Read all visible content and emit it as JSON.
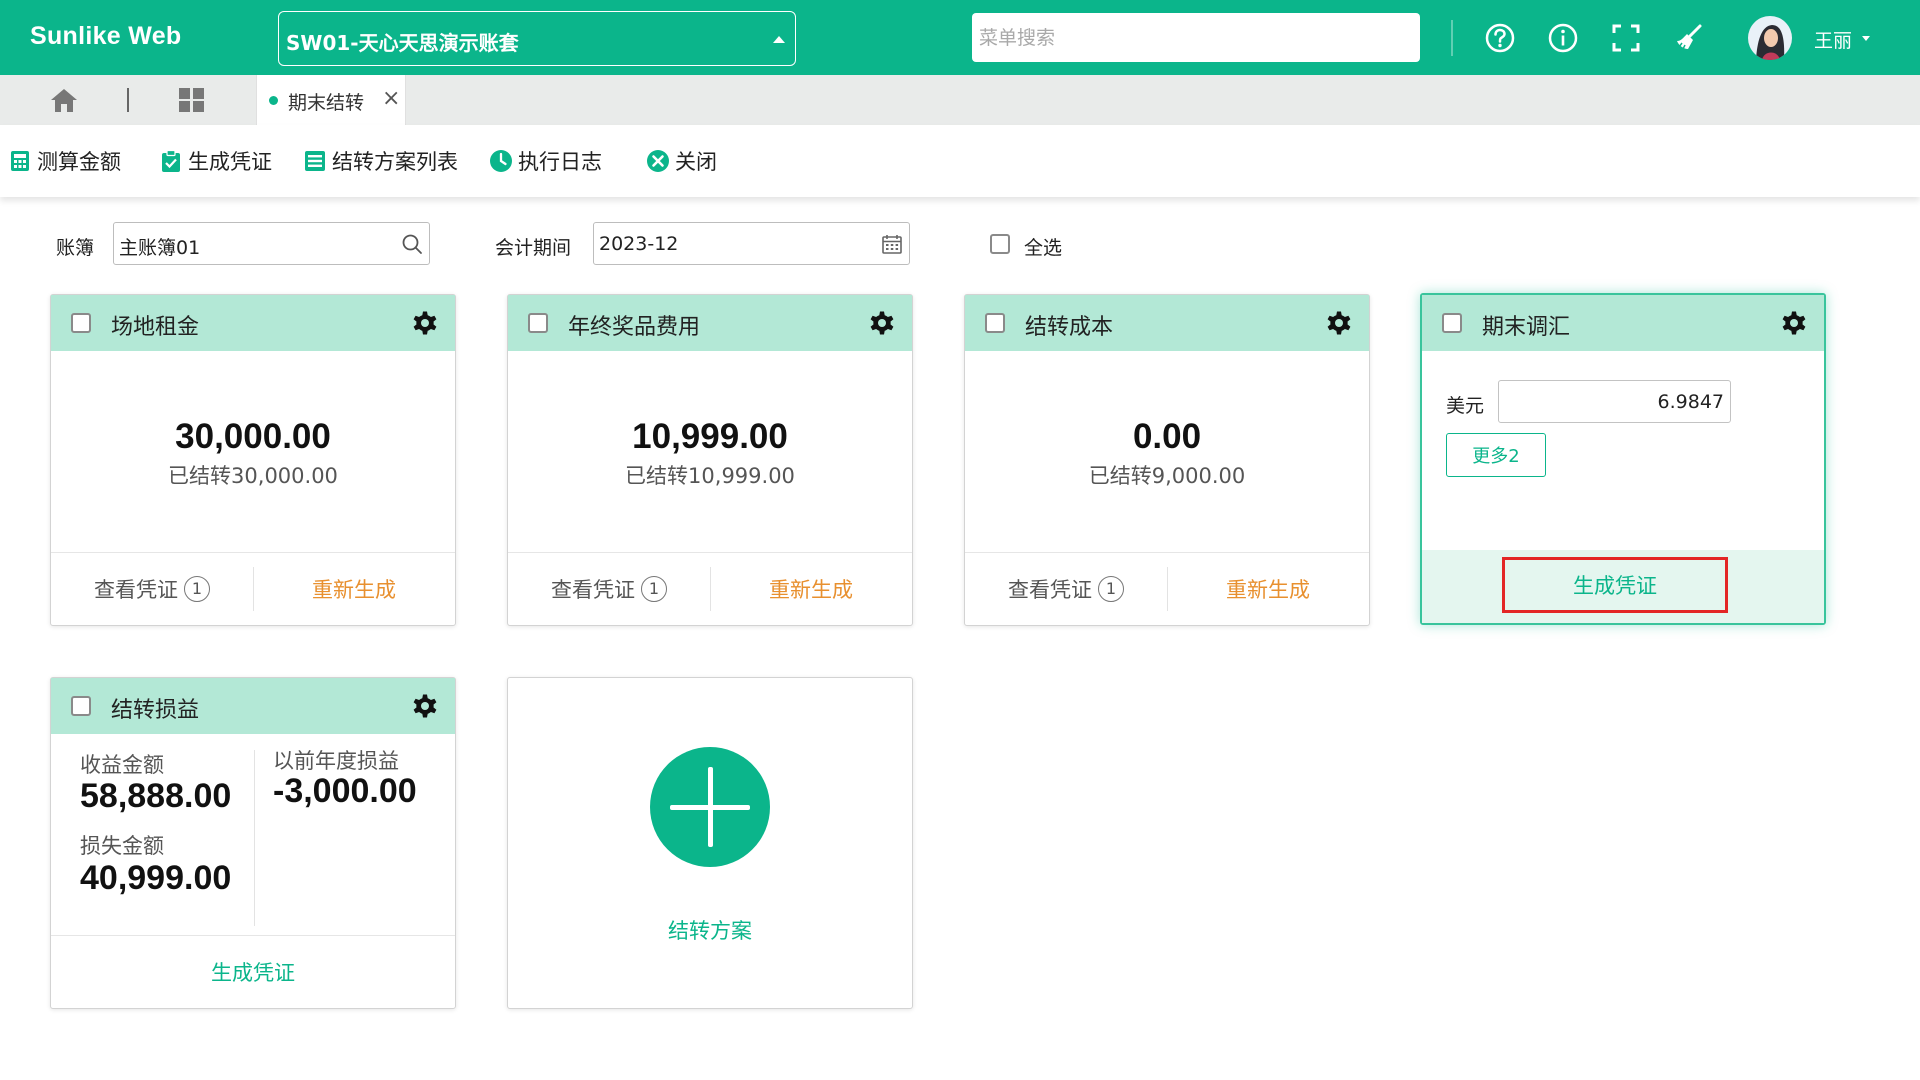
{
  "header": {
    "brand": "Sunlike Web",
    "account_set": "SW01-天心天思演示账套",
    "search_placeholder": "菜单搜索",
    "username": "王丽",
    "brand_color": "#0bb58b"
  },
  "tabs": {
    "active_label": "期末结转",
    "close_glyph": "×"
  },
  "toolbar": {
    "items": [
      {
        "label": "测算金额",
        "icon": "calculator-icon"
      },
      {
        "label": "生成凭证",
        "icon": "clipboard-icon"
      },
      {
        "label": "结转方案列表",
        "icon": "list-icon"
      },
      {
        "label": "执行日志",
        "icon": "clock-icon"
      },
      {
        "label": "关闭",
        "icon": "close-circle-icon"
      }
    ]
  },
  "filters": {
    "ledger_label": "账簿",
    "ledger_value": "主账簿01",
    "period_label": "会计期间",
    "period_value": "2023-12",
    "select_all_label": "全选"
  },
  "cards": [
    {
      "title": "场地租金",
      "amount": "30,000.00",
      "transferred": "已结转30,000.00",
      "view_label": "查看凭证",
      "view_count": "1",
      "regen_label": "重新生成"
    },
    {
      "title": "年终奖品费用",
      "amount": "10,999.00",
      "transferred": "已结转10,999.00",
      "view_label": "查看凭证",
      "view_count": "1",
      "regen_label": "重新生成"
    },
    {
      "title": "结转成本",
      "amount": "0.00",
      "transferred": "已结转9,000.00",
      "view_label": "查看凭证",
      "view_count": "1",
      "regen_label": "重新生成"
    }
  ],
  "fx_card": {
    "title": "期末调汇",
    "currency_label": "美元",
    "rate": "6.9847",
    "more_label": "更多2",
    "generate_label": "生成凭证"
  },
  "pl_card": {
    "title": "结转损益",
    "income_label": "收益金额",
    "income_value": "58,888.00",
    "loss_label": "损失金额",
    "loss_value": "40,999.00",
    "prior_label": "以前年度损益",
    "prior_value": "-3,000.00",
    "generate_label": "生成凭证"
  },
  "add_card": {
    "label": "结转方案"
  }
}
